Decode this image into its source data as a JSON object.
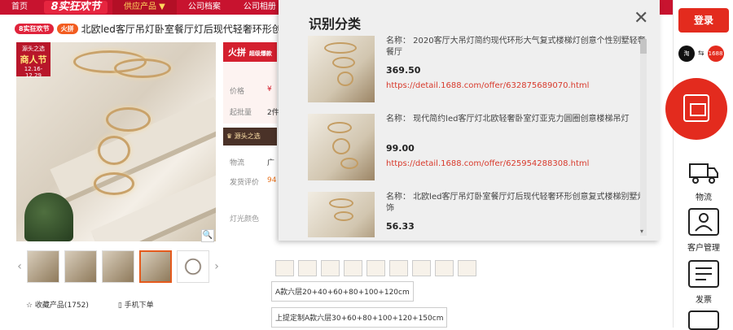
{
  "nav": {
    "items": [
      "首页",
      "8实狂欢节",
      "供应产品 ▼",
      "公司档案",
      "公司相册"
    ]
  },
  "title": {
    "tag1": "8实狂欢节",
    "tag2": "火拼",
    "text": "北欧led客厅吊灯卧室餐厅灯后现代轻奢环形创"
  },
  "product": {
    "badge_small": "源头之选",
    "badge_big": "商人节",
    "badge_date": "12.16-12.29",
    "zoom": "🔍",
    "favorite": "☆ 收藏产品(1752)",
    "order": "▯ 手机下单"
  },
  "info": {
    "pb_logo": "火拼",
    "pb_sub": "超级爆款",
    "row1_label": "价格",
    "row1_value": "¥",
    "row2_label": "起批量",
    "row2_value": "2件",
    "flag_text": "源头之选",
    "row3_label": "物流",
    "row3_value": "广",
    "row4_label": "发货评价",
    "row4_value": "94",
    "option_label": "灯光颜色",
    "option1": "A款六层20+40+60+80+100+120cm",
    "option2": "上提定制A款六层30+60+80+100+120+150cm"
  },
  "panel": {
    "title": "识别分类",
    "close": "✕",
    "results": [
      {
        "name": "名称：  2020客厅大吊灯简约现代环形大气复式楼梯灯创意个性别墅轻奢餐厅",
        "price": "369.50",
        "link": "https://detail.1688.com/offer/632875689070.html"
      },
      {
        "name": "名称：  现代简约led客厅灯北欧轻奢卧室灯亚克力圆圈创意楼梯吊灯",
        "price": "99.00",
        "link": "https://detail.1688.com/offer/625954288308.html"
      },
      {
        "name": "名称：  北欧led客厅吊灯卧室餐厅灯后现代轻奢环形创意复式楼梯别墅灯饰",
        "price": "56.33",
        "link": ""
      }
    ]
  },
  "sidebar": {
    "login": "登录",
    "sync_arrow": "⇆",
    "sync_right": "1688",
    "logistics": "物流",
    "customer": "客户管理",
    "invoice": "发票"
  }
}
